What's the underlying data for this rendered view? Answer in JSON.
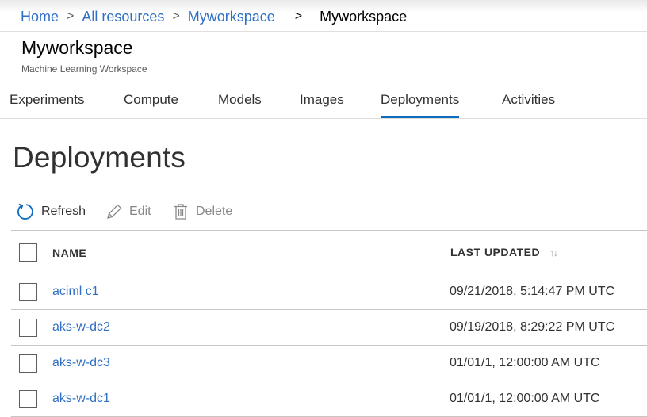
{
  "breadcrumb": {
    "items": [
      {
        "label": "Home"
      },
      {
        "label": "All resources"
      },
      {
        "label": "Myworkspace"
      }
    ],
    "separator": ">",
    "current": "Myworkspace"
  },
  "header": {
    "title": "Myworkspace",
    "subtitle": "Machine Learning Workspace"
  },
  "tabs": [
    {
      "label": "Experiments",
      "active": false
    },
    {
      "label": "Compute",
      "active": false
    },
    {
      "label": "Models",
      "active": false
    },
    {
      "label": "Images",
      "active": false
    },
    {
      "label": "Deployments",
      "active": true
    },
    {
      "label": "Activities",
      "active": false
    }
  ],
  "main": {
    "heading": "Deployments"
  },
  "toolbar": {
    "refresh": {
      "label": "Refresh",
      "icon": "refresh-icon",
      "enabled": true
    },
    "edit": {
      "label": "Edit",
      "icon": "pencil-icon",
      "enabled": false
    },
    "delete": {
      "label": "Delete",
      "icon": "trash-icon",
      "enabled": false
    }
  },
  "table": {
    "columns": {
      "name": "NAME",
      "last_updated": "LAST UPDATED",
      "sort_icon": "sort-arrows-icon"
    },
    "rows": [
      {
        "name": "aciml c1",
        "last_updated": "09/21/2018, 5:14:47 PM UTC"
      },
      {
        "name": "aks-w-dc2",
        "last_updated": "09/19/2018, 8:29:22 PM UTC"
      },
      {
        "name": "aks-w-dc3",
        "last_updated": "01/01/1, 12:00:00 AM UTC"
      },
      {
        "name": "aks-w-dc1",
        "last_updated": "01/01/1, 12:00:00 AM UTC"
      }
    ]
  },
  "colors": {
    "link": "#2f6fc4",
    "accent": "#0f6cbd",
    "text": "#323130",
    "disabled": "#8a8886",
    "border": "#c8c6c4"
  }
}
